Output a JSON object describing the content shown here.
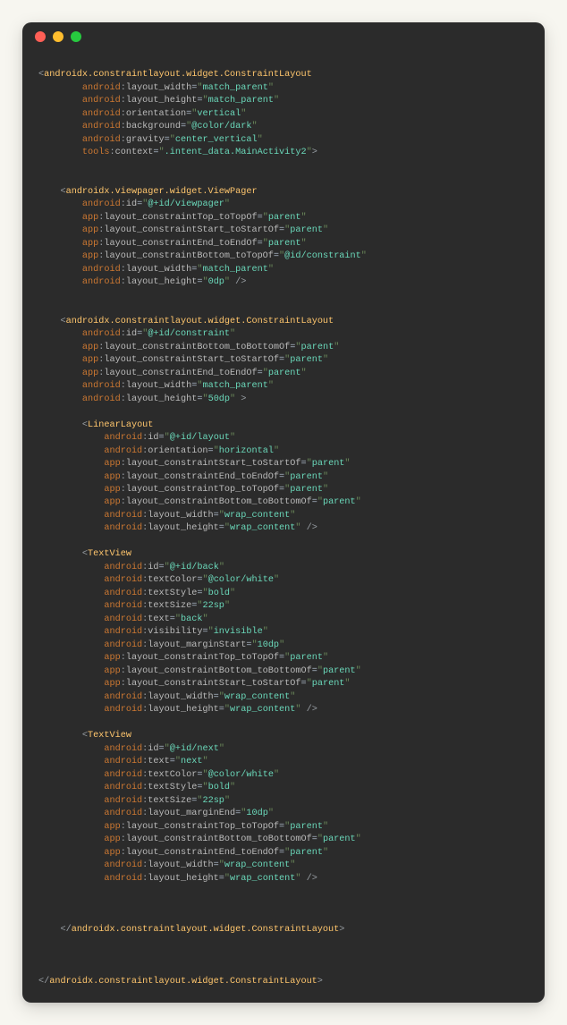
{
  "code": {
    "rootTag": "androidx.constraintlayout.widget.ConstraintLayout",
    "rootAttrs": [
      {
        "ns": "android",
        "name": "layout_width",
        "val": "match_parent"
      },
      {
        "ns": "android",
        "name": "layout_height",
        "val": "match_parent"
      },
      {
        "ns": "android",
        "name": "orientation",
        "val": "vertical"
      },
      {
        "ns": "android",
        "name": "background",
        "val": "@color/dark"
      },
      {
        "ns": "android",
        "name": "gravity",
        "val": "center_vertical"
      },
      {
        "ns": "tools",
        "name": "context",
        "val": ".intent_data.MainActivity2"
      }
    ],
    "viewPagerTag": "androidx.viewpager.widget.ViewPager",
    "viewPagerAttrs": [
      {
        "ns": "android",
        "name": "id",
        "val": "@+id/viewpager"
      },
      {
        "ns": "app",
        "name": "layout_constraintTop_toTopOf",
        "val": "parent"
      },
      {
        "ns": "app",
        "name": "layout_constraintStart_toStartOf",
        "val": "parent"
      },
      {
        "ns": "app",
        "name": "layout_constraintEnd_toEndOf",
        "val": "parent"
      },
      {
        "ns": "app",
        "name": "layout_constraintBottom_toTopOf",
        "val": "@id/constraint"
      },
      {
        "ns": "android",
        "name": "layout_width",
        "val": "match_parent"
      },
      {
        "ns": "android",
        "name": "layout_height",
        "val": "0dp"
      }
    ],
    "innerConstraintTag": "androidx.constraintlayout.widget.ConstraintLayout",
    "innerConstraintAttrs": [
      {
        "ns": "android",
        "name": "id",
        "val": "@+id/constraint"
      },
      {
        "ns": "app",
        "name": "layout_constraintBottom_toBottomOf",
        "val": "parent"
      },
      {
        "ns": "app",
        "name": "layout_constraintStart_toStartOf",
        "val": "parent"
      },
      {
        "ns": "app",
        "name": "layout_constraintEnd_toEndOf",
        "val": "parent"
      },
      {
        "ns": "android",
        "name": "layout_width",
        "val": "match_parent"
      },
      {
        "ns": "android",
        "name": "layout_height",
        "val": "50dp"
      }
    ],
    "linearLayoutTag": "LinearLayout",
    "linearLayoutAttrs": [
      {
        "ns": "android",
        "name": "id",
        "val": "@+id/layout"
      },
      {
        "ns": "android",
        "name": "orientation",
        "val": "horizontal"
      },
      {
        "ns": "app",
        "name": "layout_constraintStart_toStartOf",
        "val": "parent"
      },
      {
        "ns": "app",
        "name": "layout_constraintEnd_toEndOf",
        "val": "parent"
      },
      {
        "ns": "app",
        "name": "layout_constraintTop_toTopOf",
        "val": "parent"
      },
      {
        "ns": "app",
        "name": "layout_constraintBottom_toBottomOf",
        "val": "parent"
      },
      {
        "ns": "android",
        "name": "layout_width",
        "val": "wrap_content"
      },
      {
        "ns": "android",
        "name": "layout_height",
        "val": "wrap_content"
      }
    ],
    "textViewTag": "TextView",
    "backAttrs": [
      {
        "ns": "android",
        "name": "id",
        "val": "@+id/back"
      },
      {
        "ns": "android",
        "name": "textColor",
        "val": "@color/white"
      },
      {
        "ns": "android",
        "name": "textStyle",
        "val": "bold"
      },
      {
        "ns": "android",
        "name": "textSize",
        "val": "22sp"
      },
      {
        "ns": "android",
        "name": "text",
        "val": "back"
      },
      {
        "ns": "android",
        "name": "visibility",
        "val": "invisible"
      },
      {
        "ns": "android",
        "name": "layout_marginStart",
        "val": "10dp"
      },
      {
        "ns": "app",
        "name": "layout_constraintTop_toTopOf",
        "val": "parent"
      },
      {
        "ns": "app",
        "name": "layout_constraintBottom_toBottomOf",
        "val": "parent"
      },
      {
        "ns": "app",
        "name": "layout_constraintStart_toStartOf",
        "val": "parent"
      },
      {
        "ns": "android",
        "name": "layout_width",
        "val": "wrap_content"
      },
      {
        "ns": "android",
        "name": "layout_height",
        "val": "wrap_content"
      }
    ],
    "nextAttrs": [
      {
        "ns": "android",
        "name": "id",
        "val": "@+id/next"
      },
      {
        "ns": "android",
        "name": "text",
        "val": "next"
      },
      {
        "ns": "android",
        "name": "textColor",
        "val": "@color/white"
      },
      {
        "ns": "android",
        "name": "textStyle",
        "val": "bold"
      },
      {
        "ns": "android",
        "name": "textSize",
        "val": "22sp"
      },
      {
        "ns": "android",
        "name": "layout_marginEnd",
        "val": "10dp"
      },
      {
        "ns": "app",
        "name": "layout_constraintTop_toTopOf",
        "val": "parent"
      },
      {
        "ns": "app",
        "name": "layout_constraintBottom_toBottomOf",
        "val": "parent"
      },
      {
        "ns": "app",
        "name": "layout_constraintEnd_toEndOf",
        "val": "parent"
      },
      {
        "ns": "android",
        "name": "layout_width",
        "val": "wrap_content"
      },
      {
        "ns": "android",
        "name": "layout_height",
        "val": "wrap_content"
      }
    ],
    "closeInnerConstraint": "androidx.constraintlayout.widget.ConstraintLayout",
    "closeRoot": "androidx.constraintlayout.widget.ConstraintLayout"
  }
}
